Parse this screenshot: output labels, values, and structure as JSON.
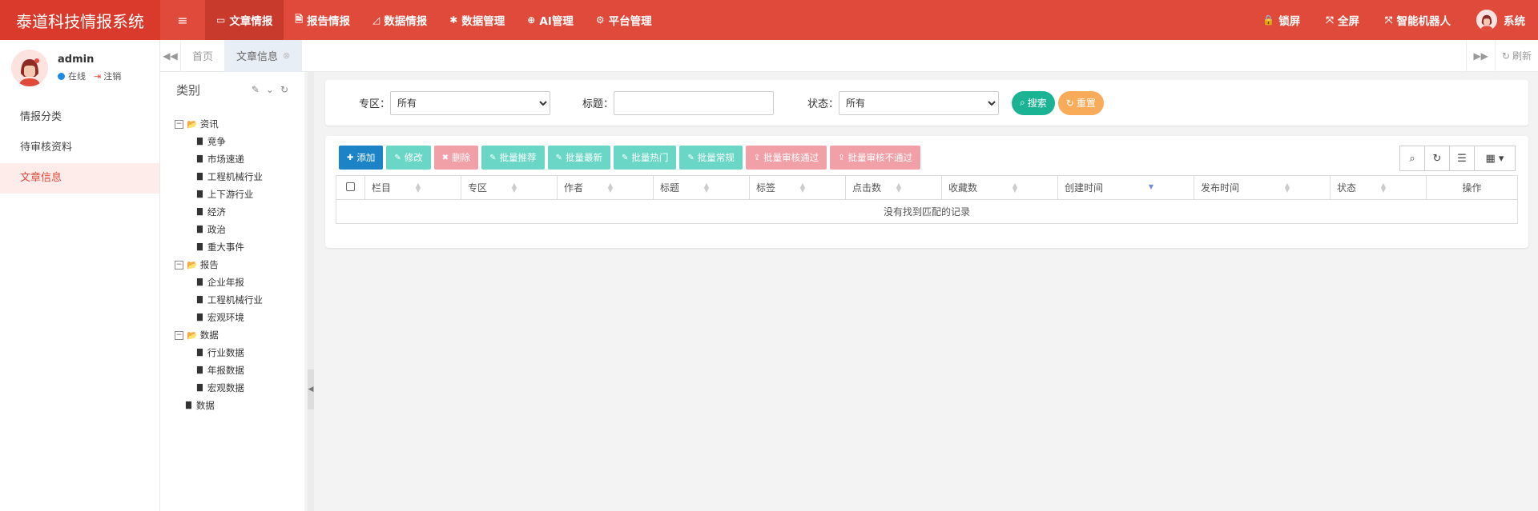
{
  "app": {
    "title": "泰道科技情报系统"
  },
  "topnav": {
    "menu_toggle": "≡",
    "items": [
      {
        "label": "文章情报",
        "icon": "monitor-icon",
        "glyph": "▭"
      },
      {
        "label": "报告情报",
        "icon": "file-pdf-icon",
        "glyph": "🗎"
      },
      {
        "label": "数据情报",
        "icon": "area-chart-icon",
        "glyph": "◿"
      },
      {
        "label": "数据管理",
        "icon": "bug-icon",
        "glyph": "✱"
      },
      {
        "label": "AI管理",
        "icon": "globe-icon",
        "glyph": "⊕"
      },
      {
        "label": "平台管理",
        "icon": "gear-icon",
        "glyph": "⚙"
      }
    ],
    "right": [
      {
        "label": "锁屏",
        "icon": "lock-icon",
        "glyph": "🔒"
      },
      {
        "label": "全屏",
        "icon": "fullscreen-icon",
        "glyph": "⤧"
      },
      {
        "label": "智能机器人",
        "icon": "robot-icon",
        "glyph": "⤧"
      },
      {
        "label": "系统",
        "icon": "avatar"
      }
    ]
  },
  "user": {
    "name": "admin",
    "status": "在线",
    "logout": "注销"
  },
  "sidebar": {
    "items": [
      {
        "label": "情报分类"
      },
      {
        "label": "待审核资料"
      },
      {
        "label": "文章信息"
      }
    ]
  },
  "tabs": {
    "items": [
      {
        "label": "首页"
      },
      {
        "label": "文章信息"
      }
    ],
    "refresh": "刷新"
  },
  "tree": {
    "title": "类别",
    "groups": [
      {
        "label": "资讯",
        "children": [
          "竞争",
          "市场速递",
          "工程机械行业",
          "上下游行业",
          "经济",
          "政治",
          "重大事件"
        ]
      },
      {
        "label": "报告",
        "children": [
          "企业年报",
          "工程机械行业",
          "宏观环境"
        ]
      },
      {
        "label": "数据",
        "children": [
          "行业数据",
          "年报数据",
          "宏观数据"
        ]
      }
    ],
    "leaf": "数据"
  },
  "search": {
    "zone_label": "专区：",
    "zone_value": "所有",
    "title_label": "标题：",
    "title_value": "",
    "status_label": "状态：",
    "status_value": "所有",
    "search_btn": "搜索",
    "reset_btn": "重置"
  },
  "toolbar": {
    "buttons": [
      {
        "label": "添加",
        "color": "#1c84c6",
        "glyph": "✚"
      },
      {
        "label": "修改",
        "color": "#6ad7c6",
        "glyph": "✎"
      },
      {
        "label": "删除",
        "color": "#f2a0a8",
        "glyph": "✖"
      },
      {
        "label": "批量推荐",
        "color": "#6ad7c6",
        "glyph": "✎"
      },
      {
        "label": "批量最新",
        "color": "#6ad7c6",
        "glyph": "✎"
      },
      {
        "label": "批量热门",
        "color": "#6ad7c6",
        "glyph": "✎"
      },
      {
        "label": "批量常规",
        "color": "#6ad7c6",
        "glyph": "✎"
      },
      {
        "label": "批量审核通过",
        "color": "#f2a0a8",
        "glyph": "⇪"
      },
      {
        "label": "批量审核不通过",
        "color": "#f2a0a8",
        "glyph": "⇪"
      }
    ]
  },
  "table": {
    "columns": [
      "栏目",
      "专区",
      "作者",
      "标题",
      "标签",
      "点击数",
      "收藏数",
      "创建时间",
      "发布时间",
      "状态",
      "操作"
    ],
    "empty_text": "没有找到匹配的记录"
  },
  "colors": {
    "brand": "#e04a3a",
    "search": "#1ab394",
    "reset": "#f8ac59"
  }
}
